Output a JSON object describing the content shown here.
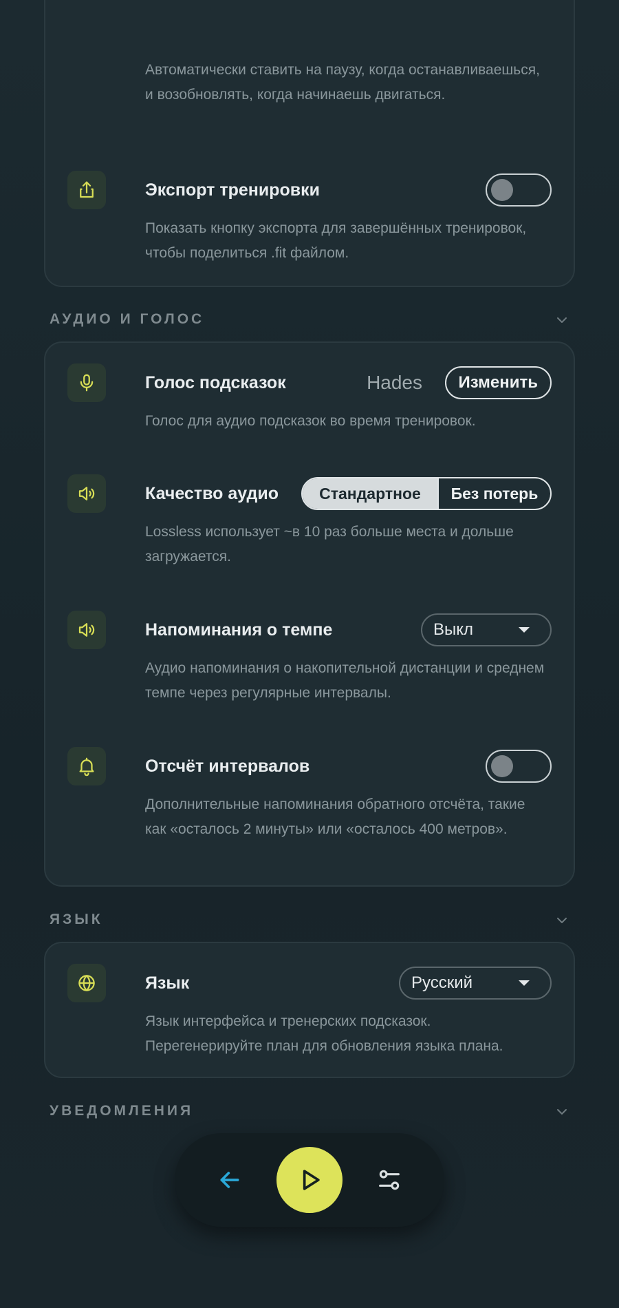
{
  "top_card": {
    "autopause_desc": "Автоматически ставить на паузу, когда останавливаешься, и возобновлять, когда начинаешь двигаться.",
    "export": {
      "title": "Экспорт тренировки",
      "desc": "Показать кнопку экспорта для завершённых тренировок, чтобы поделиться .fit файлом.",
      "enabled": false
    }
  },
  "audio_section": {
    "label": "АУДИО И ГОЛОС",
    "voice": {
      "title": "Голос подсказок",
      "value": "Hades",
      "button": "Изменить",
      "desc": "Голос для аудио подсказок во время тренировок."
    },
    "quality": {
      "title": "Качество аудио",
      "options": [
        "Стандартное",
        "Без потерь"
      ],
      "selected": "Стандартное",
      "desc": "Lossless использует ~в 10 раз больше места и дольше загружается."
    },
    "pace": {
      "title": "Напоминания о темпе",
      "value": "Выкл",
      "desc": "Аудио напоминания о накопительной дистанции и среднем темпе через регулярные интервалы."
    },
    "intervals": {
      "title": "Отсчёт интервалов",
      "desc": "Дополнительные напоминания обратного отсчёта, такие как «осталось 2 минуты» или «осталось 400 метров».",
      "enabled": false
    }
  },
  "language_section": {
    "label": "ЯЗЫК",
    "language": {
      "title": "Язык",
      "value": "Русский",
      "desc": "Язык интерфейса и тренерских подсказок. Перегенерируйте план для обновления языка плана."
    }
  },
  "notifications_section": {
    "label": "УВЕДОМЛЕНИЯ"
  },
  "colors": {
    "accent": "#dde35a",
    "icon_accent": "#d8de56",
    "back_arrow": "#2aa8d8",
    "background": "#1a262c",
    "card": "#1f2d33"
  },
  "icons": {
    "export": "share-upload-icon",
    "voice": "microphone-icon",
    "quality": "speaker-icon",
    "pace": "speaker-icon",
    "intervals": "bell-icon",
    "language": "globe-icon",
    "back": "arrow-left-icon",
    "play": "play-icon",
    "filters": "sliders-icon"
  }
}
